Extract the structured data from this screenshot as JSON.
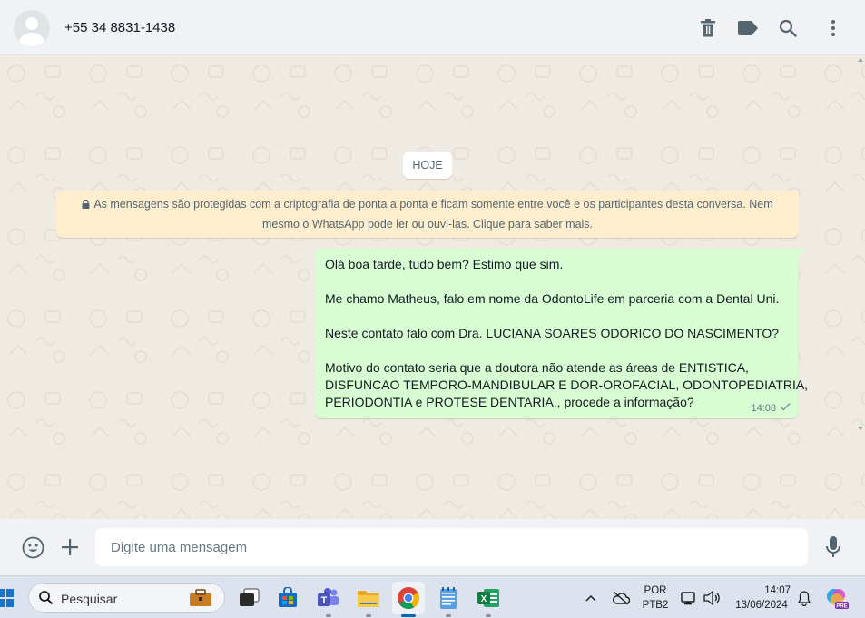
{
  "header": {
    "contact_name": "+55 34 8831-1438",
    "icons": [
      "delete-icon",
      "label-icon",
      "search-icon",
      "menu-icon"
    ]
  },
  "chat": {
    "date_chip": "HOJE",
    "notice_line1": "As mensagens são protegidas com a criptografia de ponta a ponta e ficam somente entre você e os participantes desta conversa. Nem",
    "notice_line2": "mesmo o WhatsApp pode ler ou ouvi-las. Clique para saber mais.",
    "message": {
      "lines": [
        "Olá boa tarde, tudo bem? Estimo que sim.",
        "",
        "Me chamo Matheus, falo em nome da OdontoLife em parceria com a Dental Uni.",
        "",
        "Neste contato falo com Dra. LUCIANA SOARES ODORICO DO NASCIMENTO?",
        "",
        "Motivo do contato seria que a doutora não atende as áreas de  ENTISTICA,",
        "DISFUNCAO TEMPORO-MANDIBULAR E DOR-OROFACIAL, ODONTOPEDIATRIA,",
        "PERIODONTIA e PROTESE DENTARIA., procede a informação?"
      ],
      "time": "14:08",
      "status": "sent"
    }
  },
  "composer": {
    "placeholder": "Digite uma mensagem",
    "icons": [
      "emoji-icon",
      "plus-icon",
      "microphone-icon"
    ]
  },
  "taskbar": {
    "search_placeholder": "Pesquisar",
    "language_line1": "POR",
    "language_line2": "PTB2",
    "time": "14:07",
    "date": "13/06/2024"
  },
  "colors": {
    "chat_background": "#efeae2",
    "outgoing_bubble": "#d9fdd3",
    "notice_background": "#ffeecd",
    "header_background": "#f0f2f5"
  }
}
